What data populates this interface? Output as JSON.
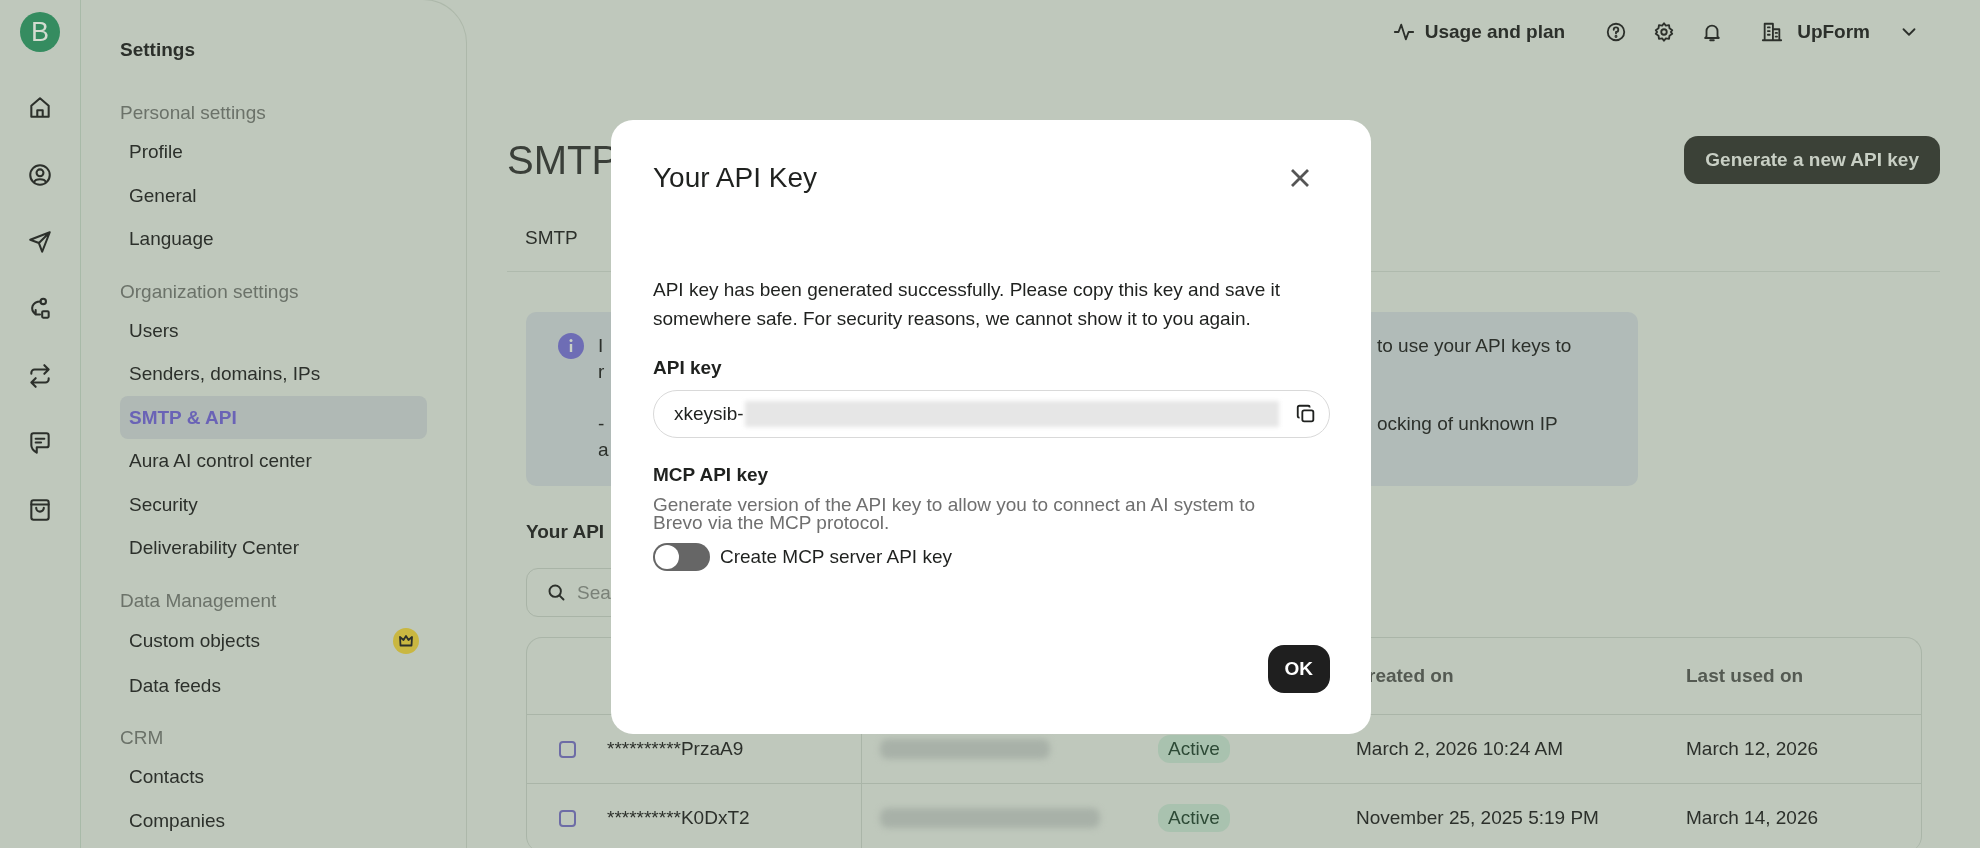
{
  "logo": "B",
  "header": {
    "usage": "Usage and plan",
    "organization": "UpForm"
  },
  "settings": {
    "title": "Settings",
    "sections": [
      {
        "label": "Personal settings",
        "items": [
          {
            "label": "Profile",
            "selected": false
          },
          {
            "label": "General",
            "selected": false
          },
          {
            "label": "Language",
            "selected": false
          }
        ]
      },
      {
        "label": "Organization settings",
        "items": [
          {
            "label": "Users",
            "selected": false
          },
          {
            "label": "Senders, domains, IPs",
            "selected": false
          },
          {
            "label": "SMTP & API",
            "selected": true
          },
          {
            "label": "Aura AI control center",
            "selected": false
          },
          {
            "label": "Security",
            "selected": false
          },
          {
            "label": "Deliverability Center",
            "selected": false
          }
        ]
      },
      {
        "label": "Data Management",
        "items": [
          {
            "label": "Custom objects",
            "selected": false,
            "premium": true
          },
          {
            "label": "Data feeds",
            "selected": false
          }
        ]
      },
      {
        "label": "CRM",
        "items": [
          {
            "label": "Contacts",
            "selected": false
          },
          {
            "label": "Companies",
            "selected": false
          }
        ]
      }
    ]
  },
  "page": {
    "title": "SMTP",
    "action": "Generate a new API key",
    "tabs": [
      "SMTP"
    ]
  },
  "info": {
    "lines": [
      {
        "left": "I",
        "right": "to use your API keys to"
      },
      {
        "left": "r"
      },
      {
        "left": "-",
        "right": "ocking of unknown IP"
      },
      {
        "left": "a"
      }
    ]
  },
  "keys": {
    "title": "Your API",
    "search_placeholder": "Sea",
    "columns": [
      "reated on",
      "Last used on"
    ],
    "rows": [
      {
        "checked": false,
        "key": "**********PrzaA9",
        "status": "Active",
        "created": "March 2, 2026 10:24 AM",
        "last_used": "March 12, 2026"
      },
      {
        "checked": false,
        "key": "**********K0DxT2",
        "status": "Active",
        "created": "November 25, 2025 5:19 PM",
        "last_used": "March 14, 2026"
      }
    ]
  },
  "modal": {
    "title": "Your API Key",
    "message": "API key has been generated successfully. Please copy this key and save it somewhere safe. For security reasons, we cannot show it to you again.",
    "key_label": "API key",
    "key_value": "xkeysib-",
    "mcp_label": "MCP API key",
    "mcp_description": "Generate version of the API key to allow you to connect an AI system to Brevo via the MCP protocol.",
    "mcp_toggle": {
      "label": "Create MCP server API key",
      "on": false
    },
    "ok": "OK"
  }
}
